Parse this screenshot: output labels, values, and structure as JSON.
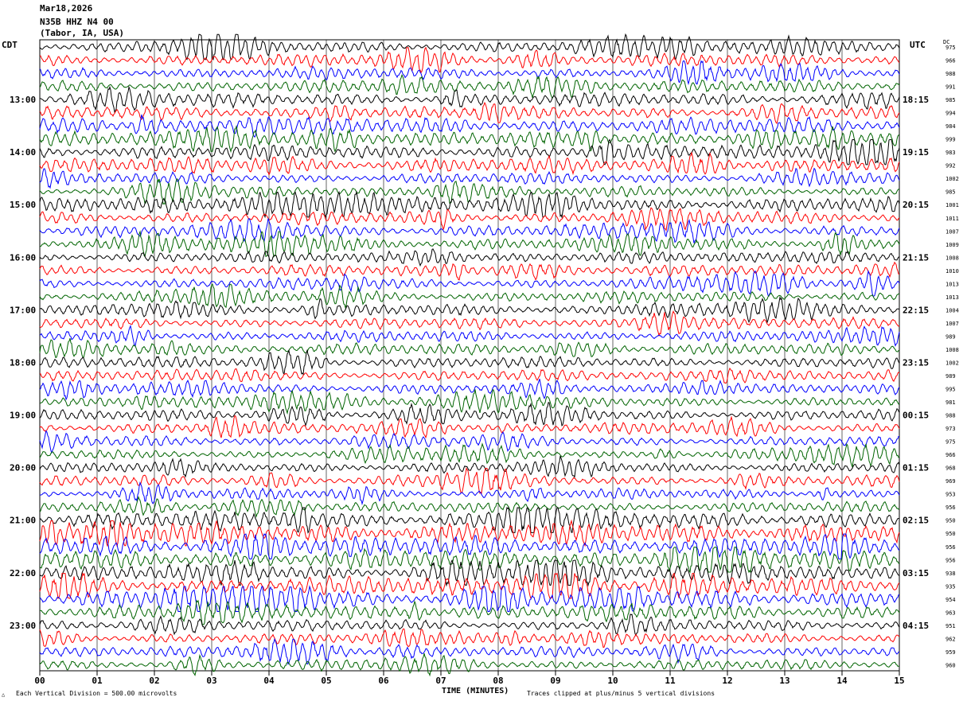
{
  "header": {
    "date": "Mar18,2026",
    "station": "N35B HHZ N4 00",
    "location": "(Tabor, IA, USA)"
  },
  "left_tz": "CDT",
  "right_tz": "UTC",
  "dc_label": "DC",
  "footer": {
    "scale_note": "Each Vertical Division =  500.00 microvolts",
    "xlabel": "TIME (MINUTES)",
    "clip_note": "Traces clipped at plus/minus 5 vertical divisions"
  },
  "colors": {
    "trace_cycle": [
      "#000000",
      "#ff0000",
      "#0000ff",
      "#006400"
    ],
    "grid": "#000000"
  },
  "chart_data": {
    "type": "line",
    "title": "",
    "xlabel": "TIME (MINUTES)",
    "ylabel": "",
    "xlim": [
      0,
      15
    ],
    "x_ticks": [
      "00",
      "01",
      "02",
      "03",
      "04",
      "05",
      "06",
      "07",
      "08",
      "09",
      "10",
      "11",
      "12",
      "13",
      "14",
      "15"
    ],
    "grid": true,
    "left_hour_labels": [
      "13:00",
      "14:00",
      "15:00",
      "16:00",
      "17:00",
      "18:00",
      "19:00",
      "20:00",
      "21:00",
      "22:00",
      "23:00"
    ],
    "right_hour_labels": [
      "18:15",
      "19:15",
      "20:15",
      "21:15",
      "22:15",
      "23:15",
      "00:15",
      "01:15",
      "02:15",
      "03:15",
      "04:15"
    ],
    "trace_dc_offsets": [
      975,
      966,
      988,
      991,
      985,
      994,
      984,
      999,
      983,
      992,
      1002,
      985,
      1001,
      1011,
      1007,
      1009,
      1008,
      1010,
      1013,
      1013,
      1004,
      1007,
      989,
      1008,
      1002,
      989,
      995,
      981,
      988,
      973,
      975,
      966,
      968,
      969,
      953,
      956,
      950,
      950,
      956,
      956,
      938,
      935,
      954,
      963,
      951,
      962,
      959,
      960
    ],
    "trace_amplitude": [
      0.35,
      0.34,
      0.33,
      0.34,
      0.36,
      0.35,
      0.45,
      0.4,
      0.4,
      0.42,
      0.3,
      0.28,
      0.4,
      0.35,
      0.36,
      0.36,
      0.3,
      0.3,
      0.3,
      0.3,
      0.3,
      0.3,
      0.3,
      0.3,
      0.3,
      0.3,
      0.28,
      0.28,
      0.3,
      0.32,
      0.28,
      0.25,
      0.3,
      0.3,
      0.28,
      0.28,
      0.5,
      0.6,
      0.55,
      0.55,
      0.45,
      0.5,
      0.55,
      0.45,
      0.3,
      0.28,
      0.28,
      0.28
    ]
  }
}
